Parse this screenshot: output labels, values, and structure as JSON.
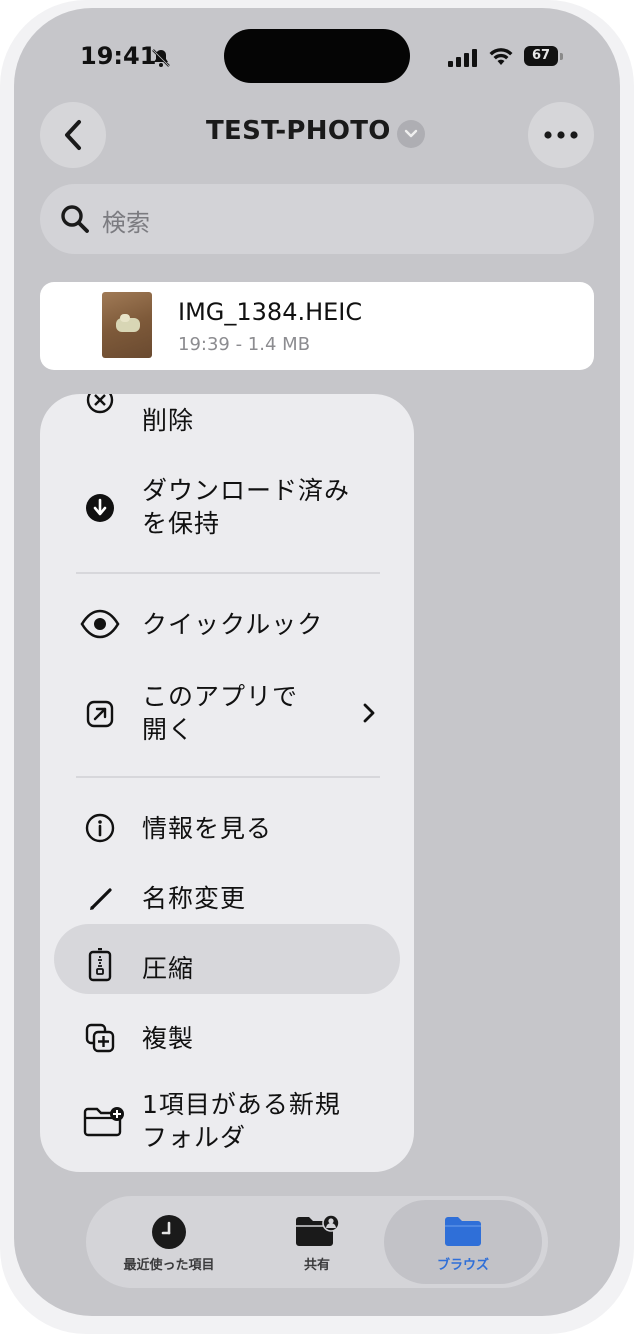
{
  "status_bar": {
    "time": "19:41",
    "battery": "67"
  },
  "nav": {
    "title": "TEST-PHOTO"
  },
  "search": {
    "placeholder": "検索"
  },
  "file": {
    "name": "IMG_1384.HEIC",
    "meta": "19:39 - 1.4 MB"
  },
  "context_menu": {
    "items": [
      {
        "label": "削除",
        "icon": "delete-x-icon"
      },
      {
        "label": "ダウンロード済み\nを保持",
        "icon": "download-arrow-icon"
      },
      {
        "label": "クイックルック",
        "icon": "eye-icon"
      },
      {
        "label": "このアプリで\n開く",
        "icon": "open-external-icon"
      },
      {
        "label": "情報を見る",
        "icon": "info-icon"
      },
      {
        "label": "名称変更",
        "icon": "pencil-icon"
      },
      {
        "label": "圧縮",
        "icon": "archive-icon"
      },
      {
        "label": "複製",
        "icon": "duplicate-icon"
      },
      {
        "label": "1項目がある新規\nフォルダ",
        "icon": "new-folder-icon"
      }
    ]
  },
  "tab_bar": {
    "tabs": [
      {
        "label": "最近使った項目",
        "icon": "clock-icon"
      },
      {
        "label": "共有",
        "icon": "shared-folder-icon"
      },
      {
        "label": "ブラウズ",
        "icon": "folder-icon",
        "active": true
      }
    ]
  },
  "colors": {
    "accent": "#2f6fd8",
    "screen_bg": "#c6c6ca",
    "menu_bg": "#ececef"
  }
}
